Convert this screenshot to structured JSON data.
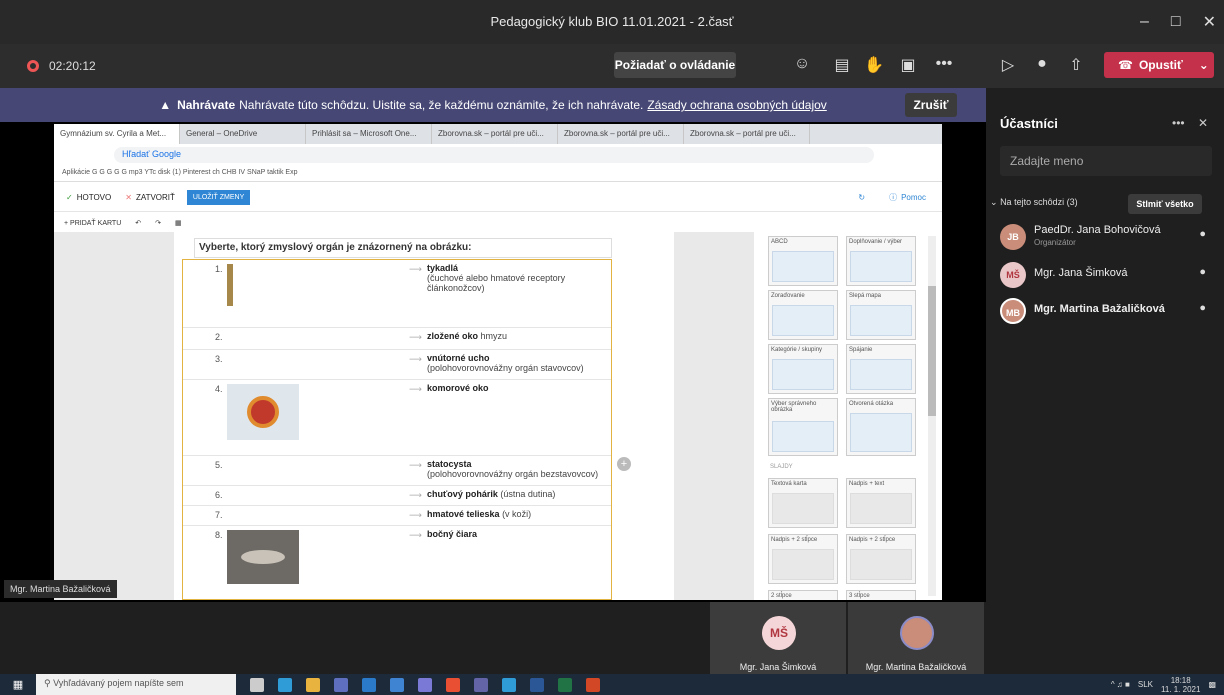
{
  "window": {
    "title": "Pedagogický klub BIO 11.01.2021 - 2.časť"
  },
  "meeting": {
    "timer": "02:20:12",
    "request_control": "Požiadať o ovládanie",
    "leave": "Opustiť"
  },
  "banner": {
    "title": "Nahrávate",
    "text": "Nahrávate túto schôdzu. Uistite sa, že každému oznámite, že ich nahrávate.",
    "link": "Zásady ochrana osobných údajov",
    "dismiss": "Zrušiť"
  },
  "browser": {
    "tabs": [
      "Gymnázium sv. Cyrila a Met...",
      "General – OneDrive",
      "Prihlásit sa – Microsoft One...",
      "Zborovna.sk – portál pre uči...",
      "Zborovna.sk – portál pre uči...",
      "Zborovna.sk – portál pre uči..."
    ],
    "address": "Hľadať Google",
    "bookmarks": "Aplikácie   G   G   G   G   G   mp3   YTc   disk   (1) Pinterest   ch   CHB   IV   SNaP   taktik   Exp"
  },
  "editor": {
    "done": "HOTOVO",
    "close": "ZATVORIŤ",
    "save": "ULOŽIŤ ZMENY",
    "help": "Pomoc",
    "add_card": "+ PRIDAŤ KARTU",
    "question": "Vyberte, ktorý zmyslový orgán je znázornený na obrázku:",
    "rows": [
      {
        "num": "1.",
        "bold": "tykadlá",
        "rest": "(čuchové alebo hmatové receptory článkonožcov)"
      },
      {
        "num": "2.",
        "bold": "zložené oko",
        "rest": "hmyzu"
      },
      {
        "num": "3.",
        "bold": "vnútorné ucho",
        "rest": "(polohovorovnovážny orgán stavovcov)"
      },
      {
        "num": "4.",
        "bold": "komorové oko",
        "rest": ""
      },
      {
        "num": "5.",
        "bold": "statocysta",
        "rest": "(polohovorovnovážny orgán bezstavovcov)"
      },
      {
        "num": "6.",
        "bold": "chuťový pohárik",
        "rest": "(ústna dutina)"
      },
      {
        "num": "7.",
        "bold": "hmatové telieska",
        "rest": "(v koži)"
      },
      {
        "num": "8.",
        "bold": "bočný čiara",
        "rest": ""
      }
    ],
    "templates": [
      "ABCD",
      "Doplňovanie / výber",
      "Zoraďovanie",
      "Slepá mapa",
      "Kategórie / skupiny",
      "Spájanie",
      "Výber správneho obrázka",
      "Otvorená otázka",
      "Textová karta",
      "Nadpis + text",
      "Nadpis + 2 stĺpce",
      "Nadpis + 2 stĺpce",
      "2 stĺpce",
      "3 stĺpce"
    ],
    "slides_label": "SLAJDY"
  },
  "presenter": "Mgr. Martina Bažaličková",
  "gallery": [
    {
      "initials": "MŠ",
      "name": "Mgr. Jana Šimková"
    },
    {
      "initials": "",
      "name": "Mgr. Martina Bažaličková"
    }
  ],
  "sidebar": {
    "title": "Účastníci",
    "search_placeholder": "Zadajte meno",
    "section": "Na tejto schôdzi (3)",
    "mute_all": "Stlmiť všetko",
    "people": [
      {
        "initials": "JB",
        "name": "PaedDr. Jana Bohovičová",
        "role": "Organizátor"
      },
      {
        "initials": "MŠ",
        "name": "Mgr. Jana Šimková",
        "role": ""
      },
      {
        "initials": "MB",
        "name": "Mgr. Martina Bažaličková",
        "role": ""
      }
    ]
  },
  "taskbar": {
    "search": "Vyhľadávaný pojem napíšte sem",
    "lang": "SLK",
    "time": "18:18",
    "date": "11. 1. 2021"
  },
  "colors": {
    "accent": "#464775",
    "leave": "#c4314b",
    "card_border": "#e3b341",
    "save": "#2f86d4"
  }
}
